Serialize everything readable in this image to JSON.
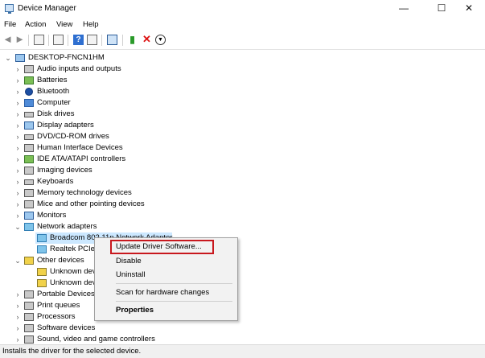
{
  "window": {
    "title": "Device Manager",
    "minimize": "—",
    "maximize": "☐",
    "close": "✕"
  },
  "menu": [
    "File",
    "Action",
    "View",
    "Help"
  ],
  "tree": {
    "root": "DESKTOP-FNCN1HM",
    "items": [
      "Audio inputs and outputs",
      "Batteries",
      "Bluetooth",
      "Computer",
      "Disk drives",
      "Display adapters",
      "DVD/CD-ROM drives",
      "Human Interface Devices",
      "IDE ATA/ATAPI controllers",
      "Imaging devices",
      "Keyboards",
      "Memory technology devices",
      "Mice and other pointing devices",
      "Monitors",
      "Network adapters",
      "Broadcom 802.11n Network Adapter",
      "Realtek PCIe GBE Family Controller",
      "Other devices",
      "Unknown device",
      "Unknown device",
      "Portable Devices",
      "Print queues",
      "Processors",
      "Software devices",
      "Sound, video and game controllers"
    ]
  },
  "context_menu": {
    "update": "Update Driver Software...",
    "disable": "Disable",
    "uninstall": "Uninstall",
    "scan": "Scan for hardware changes",
    "properties": "Properties"
  },
  "status": "Installs the driver for the selected device.",
  "colors": {
    "selection": "#cce8ff",
    "highlight_box": "#c8181e"
  }
}
